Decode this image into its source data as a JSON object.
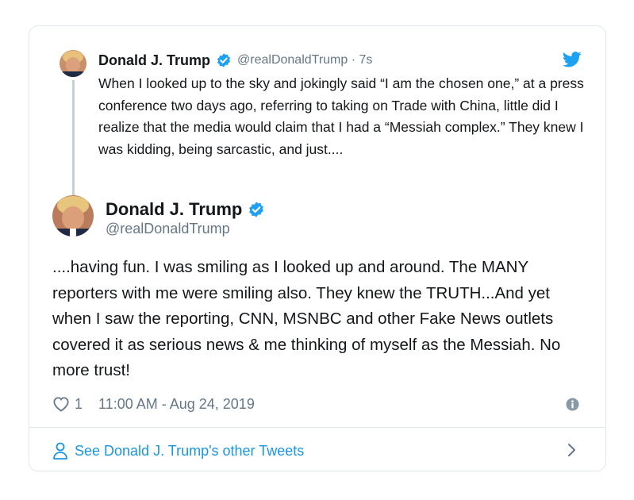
{
  "parent_tweet": {
    "name": "Donald J. Trump",
    "handle_time": "@realDonaldTrump · 7s",
    "text": "When I looked up to the sky and jokingly said “I am the chosen one,” at a press conference two days ago, referring to taking on Trade with China, little did I realize that the media would claim that I had a “Messiah complex.” They knew I was kidding, being sarcastic, and just...."
  },
  "main_tweet": {
    "name": "Donald J. Trump",
    "handle": "@realDonaldTrump",
    "text": "....having fun. I was smiling as I looked up and around. The MANY reporters with me were smiling also. They knew the TRUTH...And yet when I saw the reporting, CNN, MSNBC and other Fake News outlets covered it as serious news & me thinking of myself as the Messiah. No more trust!",
    "likes": "1",
    "timestamp": "11:00 AM - Aug 24, 2019"
  },
  "footer": {
    "link_label": "See Donald J. Trump's other Tweets"
  },
  "icons": {
    "verified": "verified-badge-icon",
    "bird": "twitter-bird-icon",
    "like": "heart-icon",
    "info": "info-icon",
    "person": "person-icon",
    "chevron": "chevron-right-icon"
  },
  "colors": {
    "link_blue": "#1b95e0",
    "secondary_text": "#657786",
    "border": "#e1e8ed"
  }
}
